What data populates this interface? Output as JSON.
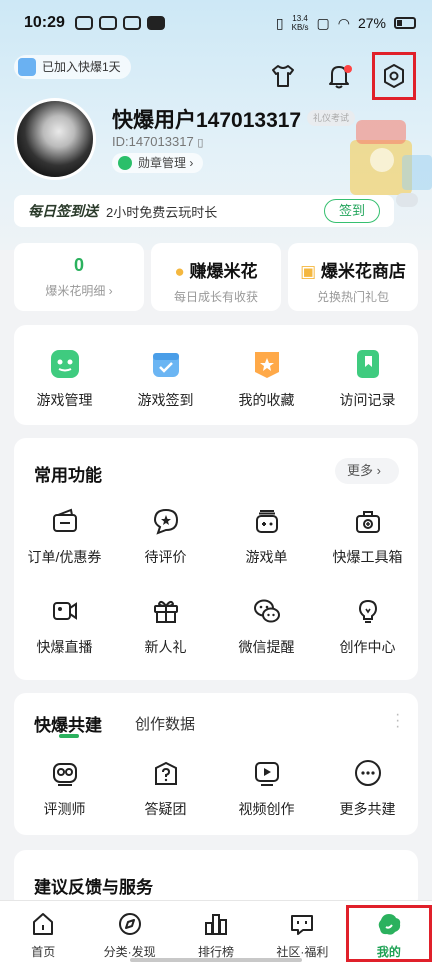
{
  "status_bar": {
    "time": "10:29",
    "net_speed_value": "13.4",
    "net_speed_unit": "KB/s",
    "battery": "27%"
  },
  "header": {
    "joined": "已加入快爆1天",
    "username": "快爆用户147013317",
    "tag": "礼仪考试",
    "user_id": "ID:147013317",
    "medal": "勋章管理"
  },
  "sign": {
    "title": "每日签到送",
    "desc": "2小时免费云玩时长",
    "button": "签到"
  },
  "stats": [
    {
      "value": "0",
      "label": "爆米花明细"
    },
    {
      "title": "赚爆米花",
      "label": "每日成长有收获"
    },
    {
      "title": "爆米花商店",
      "label": "兑换热门礼包"
    }
  ],
  "quick": [
    {
      "label": "游戏管理",
      "icon": "gamepad-icon",
      "color": "#3fcb7f"
    },
    {
      "label": "游戏签到",
      "icon": "calendar-check-icon",
      "color": "#6bb5f3"
    },
    {
      "label": "我的收藏",
      "icon": "star-folder-icon",
      "color": "#ffa948"
    },
    {
      "label": "访问记录",
      "icon": "bookmark-icon",
      "color": "#3fcb7f"
    }
  ],
  "common": {
    "title": "常用功能",
    "more": "更多",
    "items": [
      {
        "label": "订单/优惠券",
        "icon": "wallet-icon"
      },
      {
        "label": "待评价",
        "icon": "review-star-icon"
      },
      {
        "label": "游戏单",
        "icon": "game-list-icon"
      },
      {
        "label": "快爆工具箱",
        "icon": "toolbox-icon"
      },
      {
        "label": "快爆直播",
        "icon": "live-camera-icon"
      },
      {
        "label": "新人礼",
        "icon": "gift-icon"
      },
      {
        "label": "微信提醒",
        "icon": "wechat-icon"
      },
      {
        "label": "创作中心",
        "icon": "lightbulb-icon"
      }
    ]
  },
  "build": {
    "tab_active": "快爆共建",
    "tab_other": "创作数据",
    "items": [
      {
        "label": "评测师",
        "icon": "reviewer-icon"
      },
      {
        "label": "答疑团",
        "icon": "qa-icon"
      },
      {
        "label": "视频创作",
        "icon": "video-icon"
      },
      {
        "label": "更多共建",
        "icon": "more-dots-icon"
      }
    ]
  },
  "feedback": {
    "title": "建议反馈与服务"
  },
  "nav": [
    {
      "label": "首页",
      "icon": "home-icon"
    },
    {
      "label": "分类·发现",
      "icon": "compass-icon"
    },
    {
      "label": "排行榜",
      "icon": "ranking-icon"
    },
    {
      "label": "社区·福利",
      "icon": "community-icon"
    },
    {
      "label": "我的",
      "icon": "profile-icon"
    }
  ],
  "colors": {
    "accent": "#2bb15e",
    "highlight": "#e0202a"
  }
}
